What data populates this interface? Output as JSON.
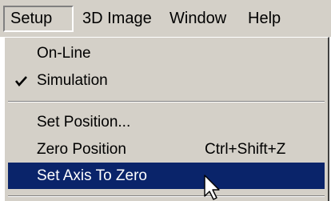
{
  "menubar": {
    "items": [
      "Setup",
      "3D Image",
      "Window",
      "Help"
    ],
    "active": "Setup"
  },
  "dropdown": {
    "items": [
      {
        "label": "On-Line",
        "checked": false,
        "shortcut": ""
      },
      {
        "label": "Simulation",
        "checked": true,
        "shortcut": ""
      },
      {
        "label": "Set Position...",
        "checked": false,
        "shortcut": ""
      },
      {
        "label": "Zero Position",
        "checked": false,
        "shortcut": "Ctrl+Shift+Z"
      },
      {
        "label": "Set Axis To Zero",
        "checked": false,
        "shortcut": "",
        "highlighted": true
      }
    ]
  },
  "colors": {
    "menu_bg": "#d4d0c8",
    "highlight_bg": "#0a246a",
    "highlight_text": "#ffffff"
  },
  "icons": {
    "check": "checkmark-icon",
    "pointer": "mouse-pointer-icon"
  }
}
